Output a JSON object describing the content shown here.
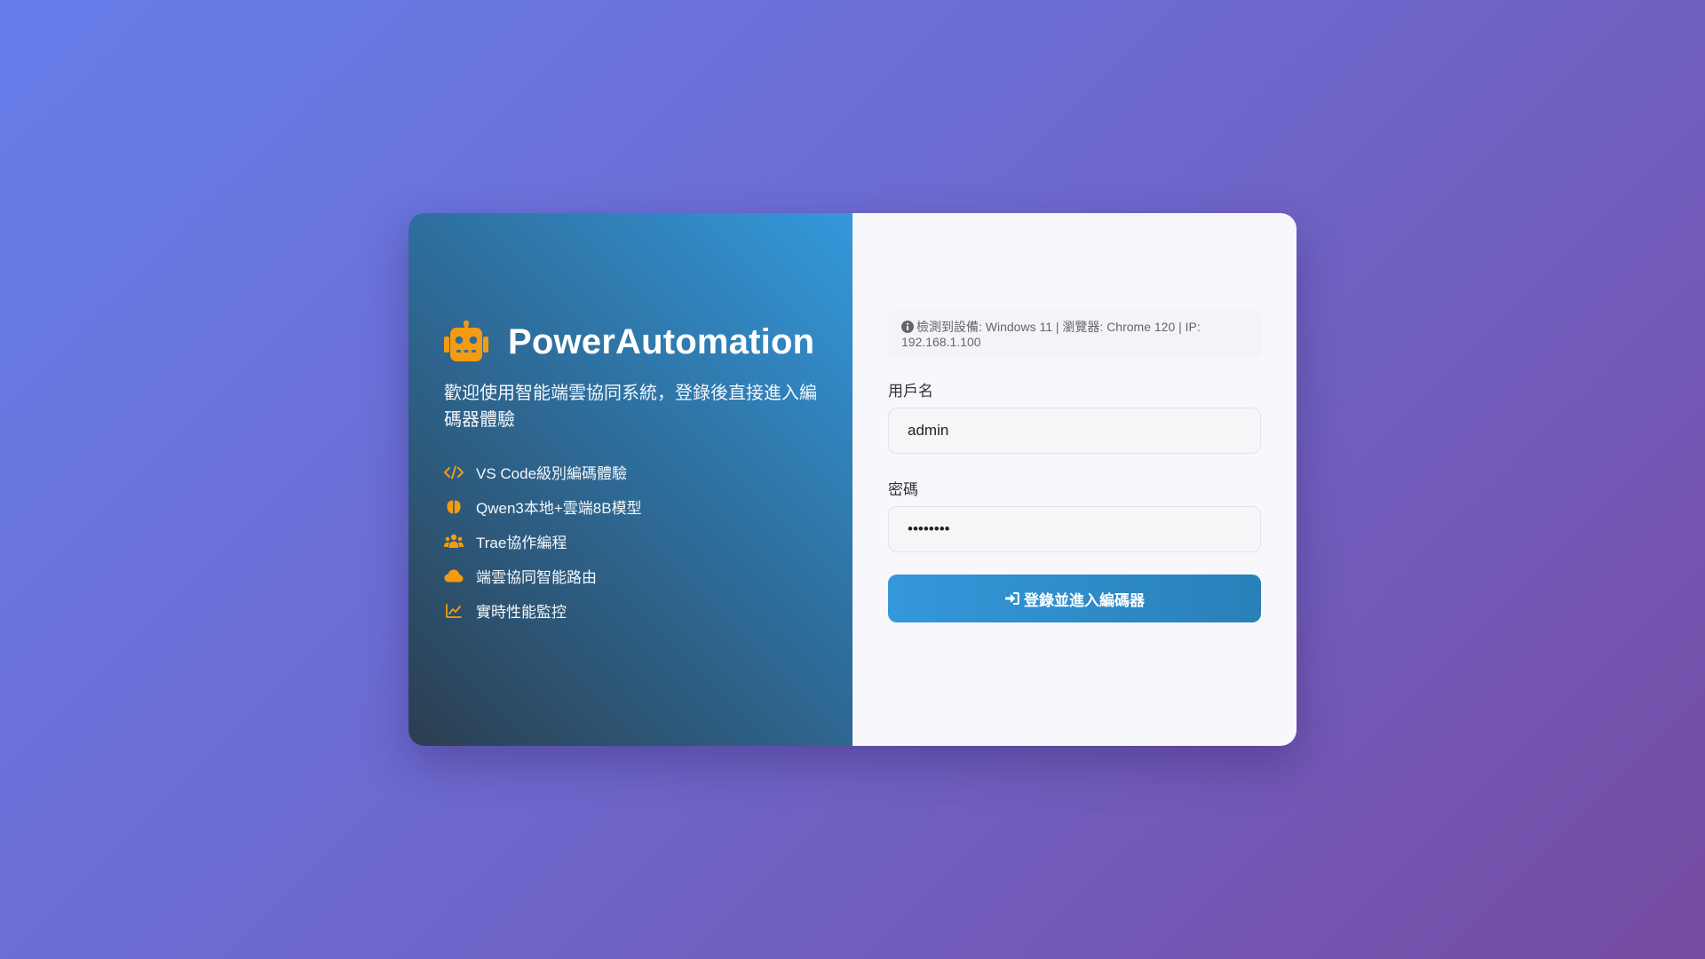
{
  "brand": {
    "title": "PowerAutomation",
    "welcome": "歡迎使用智能端雲協同系統，登錄後直接進入編碼器體驗",
    "accent_color": "#f39c12"
  },
  "features": [
    {
      "icon": "code-icon",
      "label": "VS Code級別編碼體驗"
    },
    {
      "icon": "brain-icon",
      "label": "Qwen3本地+雲端8B模型"
    },
    {
      "icon": "users-icon",
      "label": "Trae協作編程"
    },
    {
      "icon": "cloud-icon",
      "label": "端雲協同智能路由"
    },
    {
      "icon": "chart-line-icon",
      "label": "實時性能監控"
    }
  ],
  "device_info": {
    "icon": "info-circle-icon",
    "text": "檢測到設備: Windows 11 | 瀏覽器: Chrome 120 | IP: 192.168.1.100"
  },
  "form": {
    "username_label": "用戶名",
    "username_value": "admin",
    "password_label": "密碼",
    "password_value": "password",
    "submit_label": "登錄並進入編碼器",
    "submit_icon": "sign-in-icon"
  }
}
